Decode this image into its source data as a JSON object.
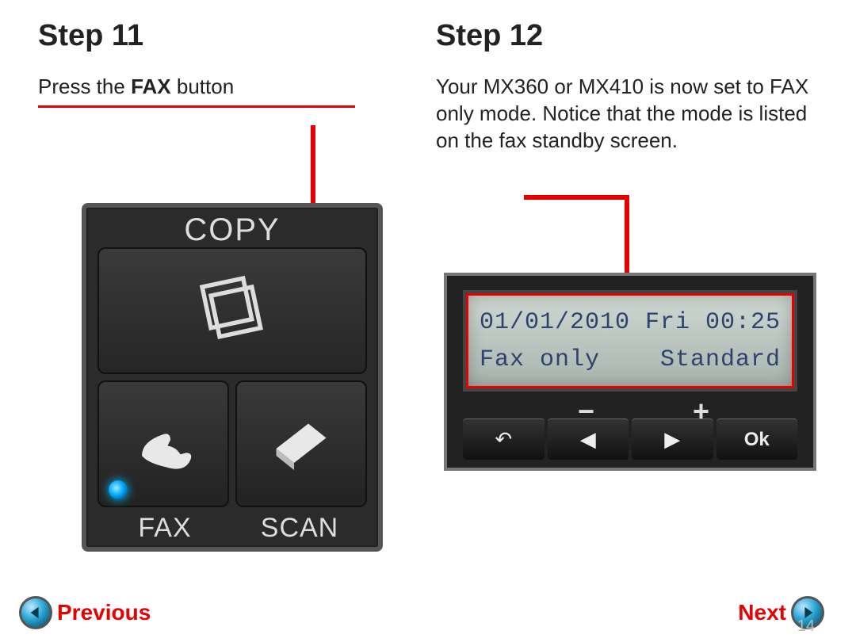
{
  "left": {
    "title": "Step 11",
    "intro_prefix": "Press the ",
    "intro_bold": "FAX",
    "intro_suffix": " button",
    "panel": {
      "copy_label": "COPY",
      "fax_label": "FAX",
      "scan_label": "SCAN"
    }
  },
  "right": {
    "title": "Step 12",
    "body": "Your MX360 or MX410 is now set to FAX only mode. Notice that the mode is listed on the fax standby screen.",
    "lcd": {
      "line1_left": "01/01/2010",
      "line1_center": "Fri",
      "line1_right": "00:25",
      "line2_left": "Fax only",
      "line2_right": "Standard"
    },
    "keys": {
      "minus": "−",
      "plus": "+",
      "back": "↶",
      "left": "◀",
      "right": "▶",
      "ok": "Ok"
    }
  },
  "footer": {
    "prev": "Previous",
    "next": "Next",
    "page": "14"
  }
}
